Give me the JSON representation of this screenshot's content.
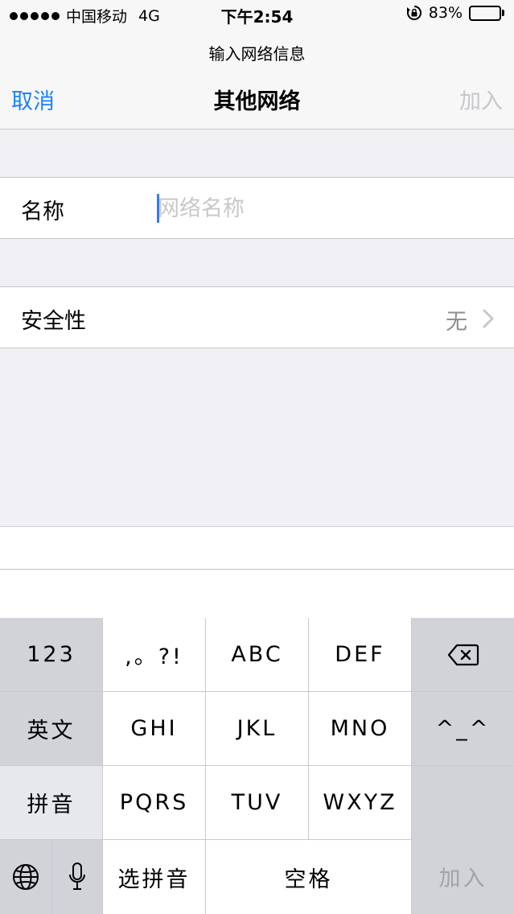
{
  "status_bar": {
    "carrier": "中国移动",
    "network": "4G",
    "time": "下午2:54",
    "battery_percent": "83%",
    "battery_level": 0.83,
    "icons": [
      "signal-dots-icon",
      "rotation-lock-icon",
      "battery-icon"
    ]
  },
  "header": {
    "prompt": "输入网络信息",
    "cancel_label": "取消",
    "title": "其他网络",
    "join_label": "加入"
  },
  "form": {
    "name_label": "名称",
    "name_value": "",
    "name_placeholder": "网络名称",
    "security_label": "安全性",
    "security_value": "无"
  },
  "keyboard": {
    "rows": [
      [
        "123",
        ",。?!",
        "ABC",
        "DEF",
        "delete"
      ],
      [
        "英文",
        "GHI",
        "JKL",
        "MNO",
        "^_^"
      ],
      [
        "拼音",
        "PQRS",
        "TUV",
        "WXYZ"
      ],
      [
        "globe",
        "mic",
        "选拼音",
        "空格",
        "加入"
      ]
    ],
    "key_123": "123",
    "key_punct": ",。?!",
    "key_abc": "ABC",
    "key_def": "DEF",
    "key_english": "英文",
    "key_ghi": "GHI",
    "key_jkl": "JKL",
    "key_mno": "MNO",
    "key_emoticon": "^_^",
    "key_pinyin": "拼音",
    "key_pqrs": "PQRS",
    "key_tuv": "TUV",
    "key_wxyz": "WXYZ",
    "key_select_pinyin": "选拼音",
    "key_space": "空格",
    "key_join": "加入"
  },
  "colors": {
    "accent": "#1a82fb",
    "disabled": "#c7c7cc",
    "caret": "#3478f6",
    "background": "#efeff4",
    "key_gray": "#d1d3d9"
  }
}
